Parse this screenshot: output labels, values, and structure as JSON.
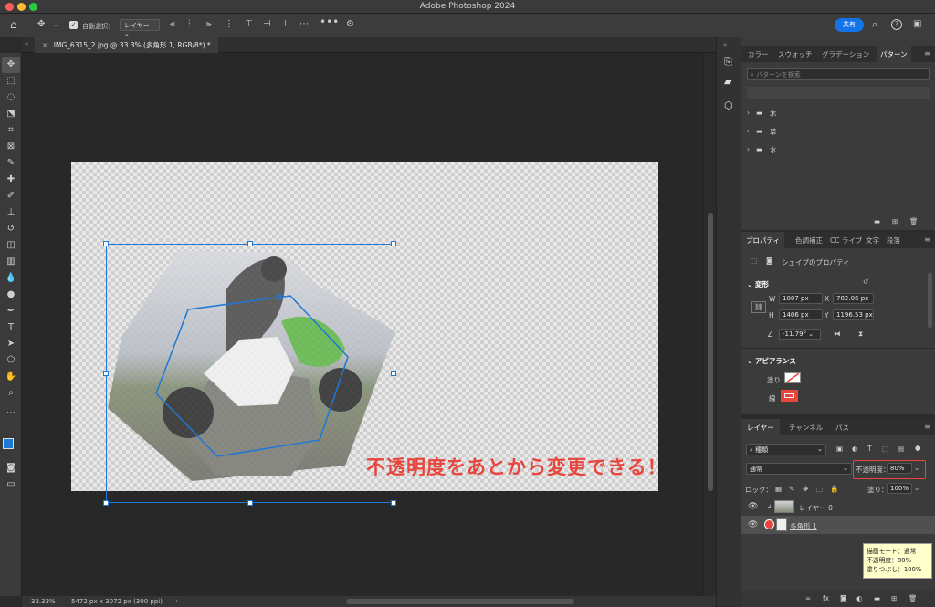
{
  "titlebar": {
    "title": "Adobe Photoshop 2024"
  },
  "options": {
    "auto_select_label": "自動選択：",
    "auto_select_value": "レイヤー",
    "share_label": "共有"
  },
  "document": {
    "tab_label": "IMG_6315_2.jpg @ 33.3% (多角形 1, RGB/8*) *"
  },
  "status": {
    "zoom": "33.33%",
    "doc_info": "5472 px x 3072 px (300 ppi)"
  },
  "annotation": {
    "text": "不透明度をあとから変更できる！"
  },
  "patterns_panel": {
    "tabs": [
      "カラー",
      "スウォッチ",
      "グラデーション",
      "パターン"
    ],
    "active_tab": "パターン",
    "search_placeholder": "パターンを検索",
    "folders": [
      "木",
      "草",
      "水"
    ]
  },
  "properties_panel": {
    "tabs": [
      "プロパティ",
      "色調補正",
      "CC ライブ",
      "文字",
      "段落"
    ],
    "active_tab": "プロパティ",
    "section_title": "シェイプのプロパティ",
    "transform_label": "変形",
    "w_label": "W",
    "w_value": "1807 px",
    "x_label": "X",
    "x_value": "782.06 px",
    "h_label": "H",
    "h_value": "1406 px",
    "y_label": "Y",
    "y_value": "1196.53 px",
    "angle_value": "-11.79°",
    "appearance_label": "アピアランス",
    "fill_label": "塗り",
    "stroke_label": "線"
  },
  "layers_panel": {
    "tabs": [
      "レイヤー",
      "チャンネル",
      "パス"
    ],
    "active_tab": "レイヤー",
    "filter_value": "種類",
    "blend_mode": "通常",
    "opacity_label": "不透明度：",
    "opacity_value": "80%",
    "lock_label": "ロック：",
    "fill_label": "塗り：",
    "fill_value": "100%",
    "layers": [
      {
        "name": "レイヤー 0"
      },
      {
        "name": "多角形 1"
      }
    ]
  },
  "tooltip": {
    "line1": "描画モード：通常",
    "line2": "不透明度：80%",
    "line3": "塗りつぶし：100%"
  },
  "colors": {
    "accent": "#1473e6",
    "annotation": "#e8453c",
    "foreground": "#1e78d6",
    "background": "#ffffff"
  }
}
